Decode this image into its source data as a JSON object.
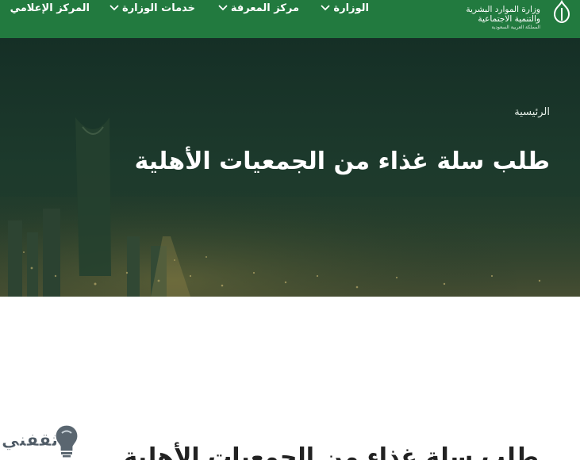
{
  "header": {
    "logo": {
      "line1": "وزارة الموارد البشرية",
      "line2": "والتنمية الاجتماعية",
      "line3": "المملكة العربية السعودية"
    },
    "nav": [
      {
        "label": "الوزارة",
        "icon": "chevron-down-icon"
      },
      {
        "label": "مركز المعرفة",
        "icon": "chevron-down-icon"
      },
      {
        "label": "خدمات الوزارة",
        "icon": "chevron-down-icon"
      },
      {
        "label": "المركز الإعلامي",
        "icon": "chevron-down-icon"
      }
    ]
  },
  "hero": {
    "breadcrumb": "الرئيسية",
    "title": "طلب سلة غذاء من الجمعيات الأهلية"
  },
  "main": {
    "title": "طلب سلة غذاء من الجمعيات الأهلية"
  },
  "watermark": {
    "text": "ثقفني"
  },
  "colors": {
    "brand_green": "#227a3f",
    "hero_dark": "#1b3a2d"
  }
}
